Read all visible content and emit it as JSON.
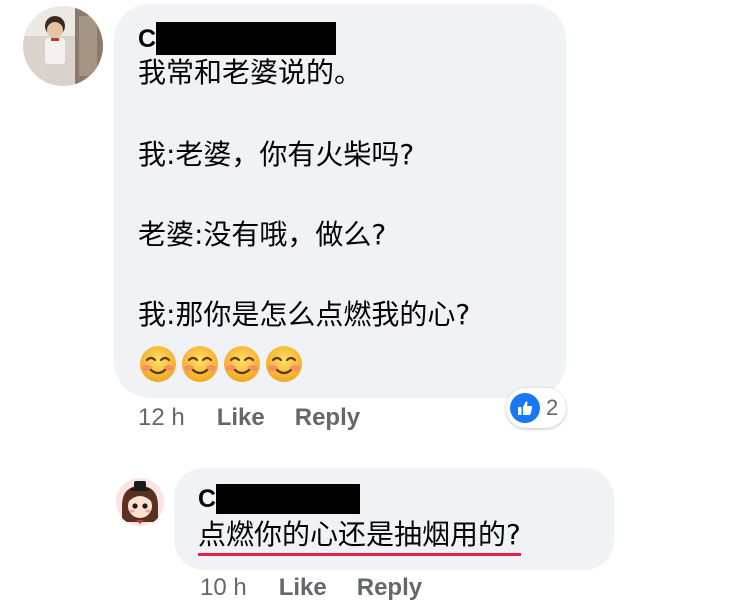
{
  "comment1": {
    "author_initial": "C",
    "lines": [
      "我常和老婆说的。",
      "我:老婆，你有火柴吗?",
      "老婆:没有哦，做么?",
      "我:那你是怎么点燃我的心?"
    ],
    "emojis": [
      "smiling-face-icon",
      "smiling-face-icon",
      "smiling-face-icon",
      "smiling-face-icon"
    ],
    "time": "12 h",
    "like_label": "Like",
    "reply_label": "Reply",
    "reaction_count": "2",
    "reaction_icon": "thumbs-up-icon"
  },
  "comment2": {
    "author_initial": "C",
    "text": "点燃你的心还是抽烟用的?",
    "time": "10 h",
    "like_label": "Like",
    "reply_label": "Reply"
  },
  "colors": {
    "bubble": "#f0f2f5",
    "meta_text": "#65676b",
    "like_blue": "#1877f2",
    "underline_red": "#e0244c"
  }
}
